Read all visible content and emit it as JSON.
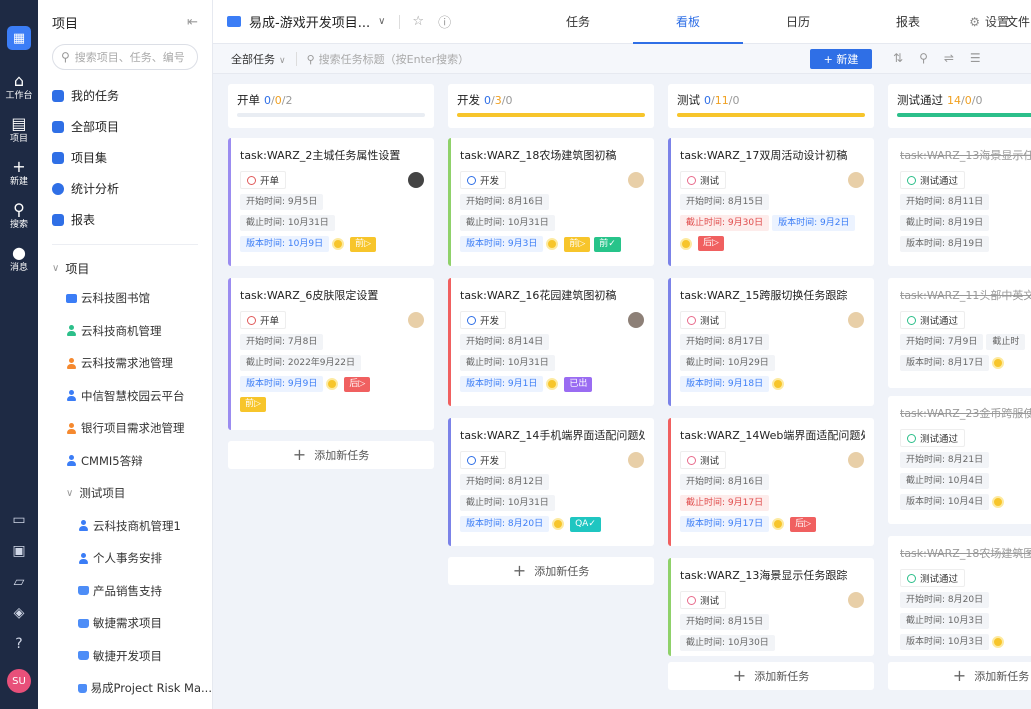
{
  "rail": {
    "items": [
      {
        "label": "工作台",
        "icon": "home-icon"
      },
      {
        "label": "项目",
        "icon": "project-icon"
      },
      {
        "label": "新建",
        "icon": "plus-icon"
      },
      {
        "label": "搜索",
        "icon": "search-icon"
      },
      {
        "label": "消息",
        "icon": "message-icon"
      }
    ],
    "user_initials": "SU"
  },
  "sidebar": {
    "title": "项目",
    "search_placeholder": "搜索项目、任务、编号",
    "menu": [
      {
        "label": "我的任务"
      },
      {
        "label": "全部项目"
      },
      {
        "label": "项目集"
      },
      {
        "label": "统计分析"
      },
      {
        "label": "报表"
      }
    ],
    "tree_title": "项目",
    "projects": [
      {
        "label": "云科技图书馆"
      },
      {
        "label": "云科技商机管理"
      },
      {
        "label": "云科技需求池管理"
      },
      {
        "label": "中信智慧校园云平台"
      },
      {
        "label": "银行项目需求池管理"
      },
      {
        "label": "CMMI5答辩"
      }
    ],
    "folder": "测试项目",
    "sub_projects": [
      {
        "label": "云科技商机管理1"
      },
      {
        "label": "个人事务安排"
      },
      {
        "label": "产品销售支持"
      },
      {
        "label": "敏捷需求项目"
      },
      {
        "label": "敏捷开发项目"
      },
      {
        "label": "易成Project Risk Ma..."
      }
    ]
  },
  "header": {
    "project_name": "易成-游戏开发项目...",
    "tabs": [
      "任务",
      "看板",
      "日历",
      "报表",
      "文件"
    ],
    "active_tab": "看板",
    "settings": "设置"
  },
  "toolbar": {
    "filter": "全部任务",
    "search_placeholder": "搜索任务标题（按Enter搜索）",
    "new_button": "+ 新建"
  },
  "columns": [
    {
      "name": "开单",
      "c1": "0",
      "c2": "0",
      "c3": "2",
      "bar_color": "#e9edf3",
      "add": "添加新任务",
      "cards": [
        {
          "title": "task:WARZ_2主城任务属性设置",
          "status": "开单",
          "start": "开始时间: 9月5日",
          "end": "截止时间: 10月31日",
          "version": "版本时间: 10月9日",
          "tags": [
            "前▷"
          ]
        },
        {
          "title": "task:WARZ_6皮肤限定设置",
          "status": "开单",
          "start": "开始时间: 7月8日",
          "end": "截止时间: 2022年9月22日",
          "version": "版本时间: 9月9日",
          "tags": [
            "后▷",
            "前▷"
          ]
        }
      ]
    },
    {
      "name": "开发",
      "c1": "0",
      "c2": "3",
      "c3": "0",
      "bar_color": "#f7c52b",
      "add": "添加新任务",
      "cards": [
        {
          "title": "task:WARZ_18农场建筑图初稿",
          "status": "开发",
          "start": "开始时间: 8月16日",
          "end": "截止时间: 10月31日",
          "version": "版本时间: 9月3日",
          "tags": [
            "前▷",
            "前✓"
          ]
        },
        {
          "title": "task:WARZ_16花园建筑图初稿",
          "status": "开发",
          "start": "开始时间: 8月14日",
          "end": "截止时间: 10月31日",
          "version": "版本时间: 9月1日",
          "tags": [
            "已出"
          ]
        },
        {
          "title": "task:WARZ_14手机端界面适配问题处理",
          "status": "开发",
          "start": "开始时间: 8月12日",
          "end": "截止时间: 10月31日",
          "version": "版本时间: 8月20日",
          "tags": [
            "QA✓"
          ]
        }
      ]
    },
    {
      "name": "测试",
      "c1": "0",
      "c2": "11",
      "c3": "0",
      "bar_color": "#f7c52b",
      "add": "添加新任务",
      "cards": [
        {
          "title": "task:WARZ_17双周活动设计初稿",
          "status": "测试",
          "start": "开始时间: 8月15日",
          "end": "截止时间: 9月30日",
          "version": "版本时间: 9月2日",
          "tags": [
            "后▷"
          ]
        },
        {
          "title": "task:WARZ_15跨服切换任务跟踪",
          "status": "测试",
          "start": "开始时间: 8月17日",
          "end": "截止时间: 10月29日",
          "version": "版本时间: 9月18日",
          "tags": []
        },
        {
          "title": "task:WARZ_14Web端界面适配问题处理",
          "status": "测试",
          "start": "开始时间: 8月16日",
          "end": "截止时间: 9月17日",
          "version": "版本时间: 9月17日",
          "tags": [
            "后▷"
          ]
        },
        {
          "title": "task:WARZ_13海景显示任务跟踪",
          "status": "测试",
          "start": "开始时间: 8月15日",
          "end": "截止时间: 10月30日",
          "version": "",
          "tags": []
        }
      ]
    },
    {
      "name": "测试通过",
      "c1": "14",
      "c2": "0",
      "c3": "0",
      "bar_color": "#2cbf8a",
      "add": "添加新任务",
      "cards": [
        {
          "title": "task:WARZ_13海景显示任务",
          "status": "测试通过",
          "start": "开始时间: 8月11日",
          "end": "截止时间: 8月19日",
          "version": "版本时间: 8月19日",
          "tags": []
        },
        {
          "title": "task:WARZ_11头部中英文对",
          "status": "测试通过",
          "start": "开始时间: 7月9日",
          "end": "截止时",
          "version": "版本时间: 8月17日",
          "tags": []
        },
        {
          "title": "task:WARZ_23金币跨服使",
          "status": "测试通过",
          "start": "开始时间: 8月21日",
          "end": "截止时间: 10月4日",
          "version": "版本时间: 10月4日",
          "tags": []
        },
        {
          "title": "task:WARZ_18农场建筑图",
          "status": "测试通过",
          "start": "开始时间: 8月20日",
          "end": "截止时间: 10月3日",
          "version": "版本时间: 10月3日",
          "tags": []
        }
      ]
    }
  ]
}
